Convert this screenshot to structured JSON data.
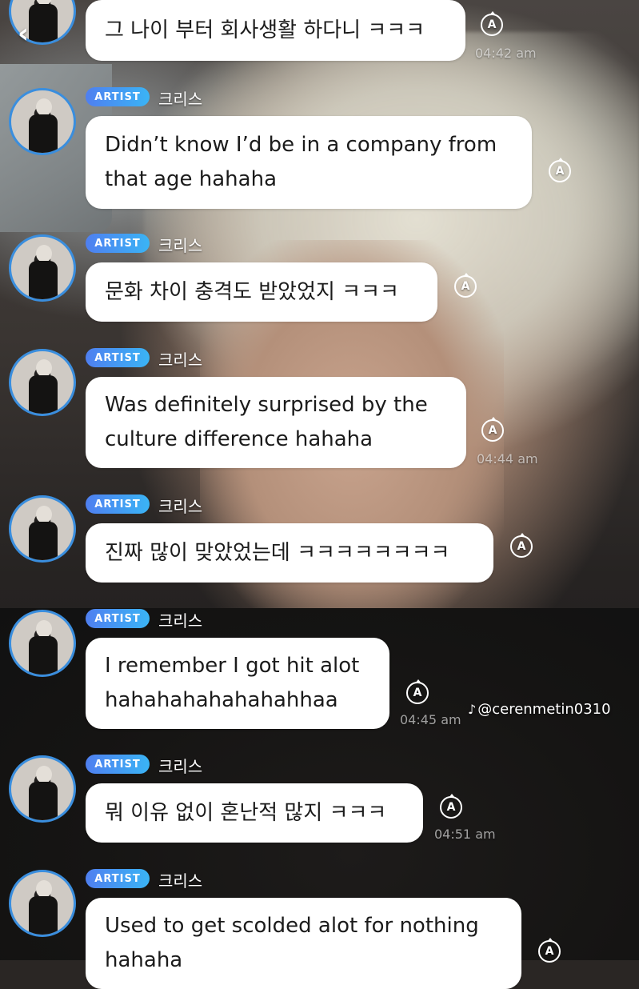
{
  "header": {
    "back_icon": "chevron-left-icon"
  },
  "badge_label": "ARTIST",
  "artist_name": "크리스",
  "messages": [
    {
      "text": "그 나이 부터 회사생활 하다니 ㅋㅋㅋ",
      "time": "04:42 am"
    },
    {
      "text": "Didn’t know I’d be in a company from\nthat age hahaha",
      "time": ""
    },
    {
      "text": "문화 차이 충격도 받았었지 ㅋㅋㅋ",
      "time": ""
    },
    {
      "text": "Was definitely surprised by the\nculture difference hahaha",
      "time": "04:44 am"
    },
    {
      "text": "진짜 많이 맞았었는데 ㅋㅋㅋㅋㅋㅋㅋㅋ",
      "time": ""
    },
    {
      "text": "I remember I got hit alot\nhahahahahahahahhaa",
      "time": "04:45 am"
    },
    {
      "text": "뭐 이유 없이 혼난적 많지 ㅋㅋㅋ",
      "time": "04:51 am"
    },
    {
      "text": "Used to get scolded alot for nothing\nhahaha",
      "time": ""
    }
  ],
  "translate_icon": {
    "name": "translate-icon",
    "glyph": "A"
  },
  "watermark": {
    "icon": "tiktok-icon",
    "glyph": "♪",
    "text": "@cerenmetin0310"
  }
}
